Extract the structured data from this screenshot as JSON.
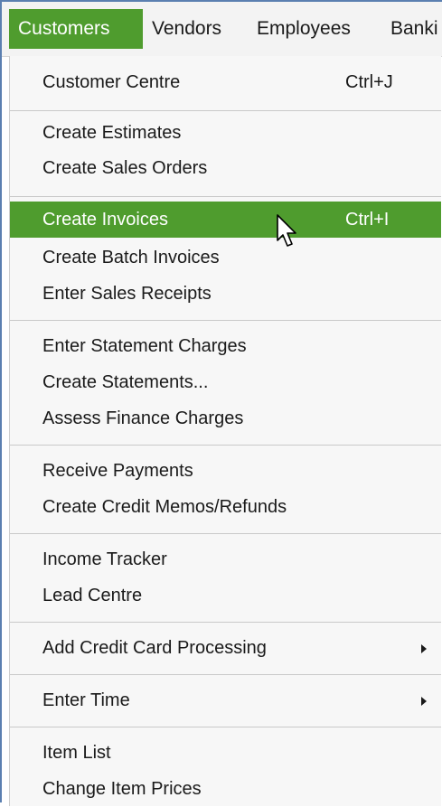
{
  "menubar": {
    "items": [
      {
        "label": "Customers"
      },
      {
        "label": "Vendors"
      },
      {
        "label": "Employees"
      },
      {
        "label": "Banki"
      }
    ]
  },
  "menu": {
    "items": [
      {
        "label": "Customer Centre",
        "shortcut": "Ctrl+J"
      },
      {
        "label": "Create Estimates"
      },
      {
        "label": "Create Sales Orders"
      },
      {
        "label": "Create Invoices",
        "shortcut": "Ctrl+I"
      },
      {
        "label": "Create Batch Invoices"
      },
      {
        "label": "Enter Sales Receipts"
      },
      {
        "label": "Enter Statement Charges"
      },
      {
        "label": "Create Statements..."
      },
      {
        "label": "Assess Finance Charges"
      },
      {
        "label": "Receive Payments"
      },
      {
        "label": "Create Credit Memos/Refunds"
      },
      {
        "label": "Income Tracker"
      },
      {
        "label": "Lead Centre"
      },
      {
        "label": "Add Credit Card Processing"
      },
      {
        "label": "Enter Time"
      },
      {
        "label": "Item List"
      },
      {
        "label": "Change Item Prices"
      }
    ]
  },
  "colors": {
    "highlight": "#4f9c2e",
    "border": "#5b7fb0"
  },
  "icons": {
    "cursor": "mouse-pointer-icon",
    "submenu": "submenu-arrow-icon"
  }
}
